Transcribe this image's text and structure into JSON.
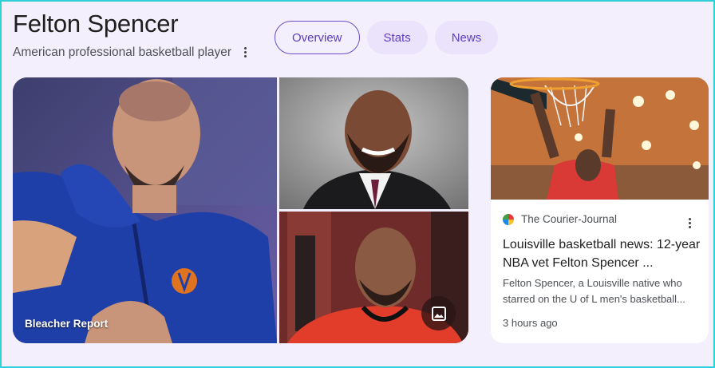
{
  "header": {
    "title": "Felton Spencer",
    "subtitle": "American professional basketball player"
  },
  "tabs": [
    {
      "label": "Overview",
      "active": true
    },
    {
      "label": "Stats",
      "active": false
    },
    {
      "label": "News",
      "active": false
    }
  ],
  "gallery": {
    "main_caption": "Bleacher Report"
  },
  "news_card": {
    "source": "The Courier-Journal",
    "headline": "Louisville basketball news: 12-year NBA vet Felton Spencer ...",
    "snippet": "Felton Spencer, a Louisville native who starred on the U of L men's basketball...",
    "time": "3 hours ago"
  },
  "colors": {
    "accent": "#5f3dc4",
    "tab_bg": "#ebe3fb",
    "page_bg": "#f3effc"
  }
}
